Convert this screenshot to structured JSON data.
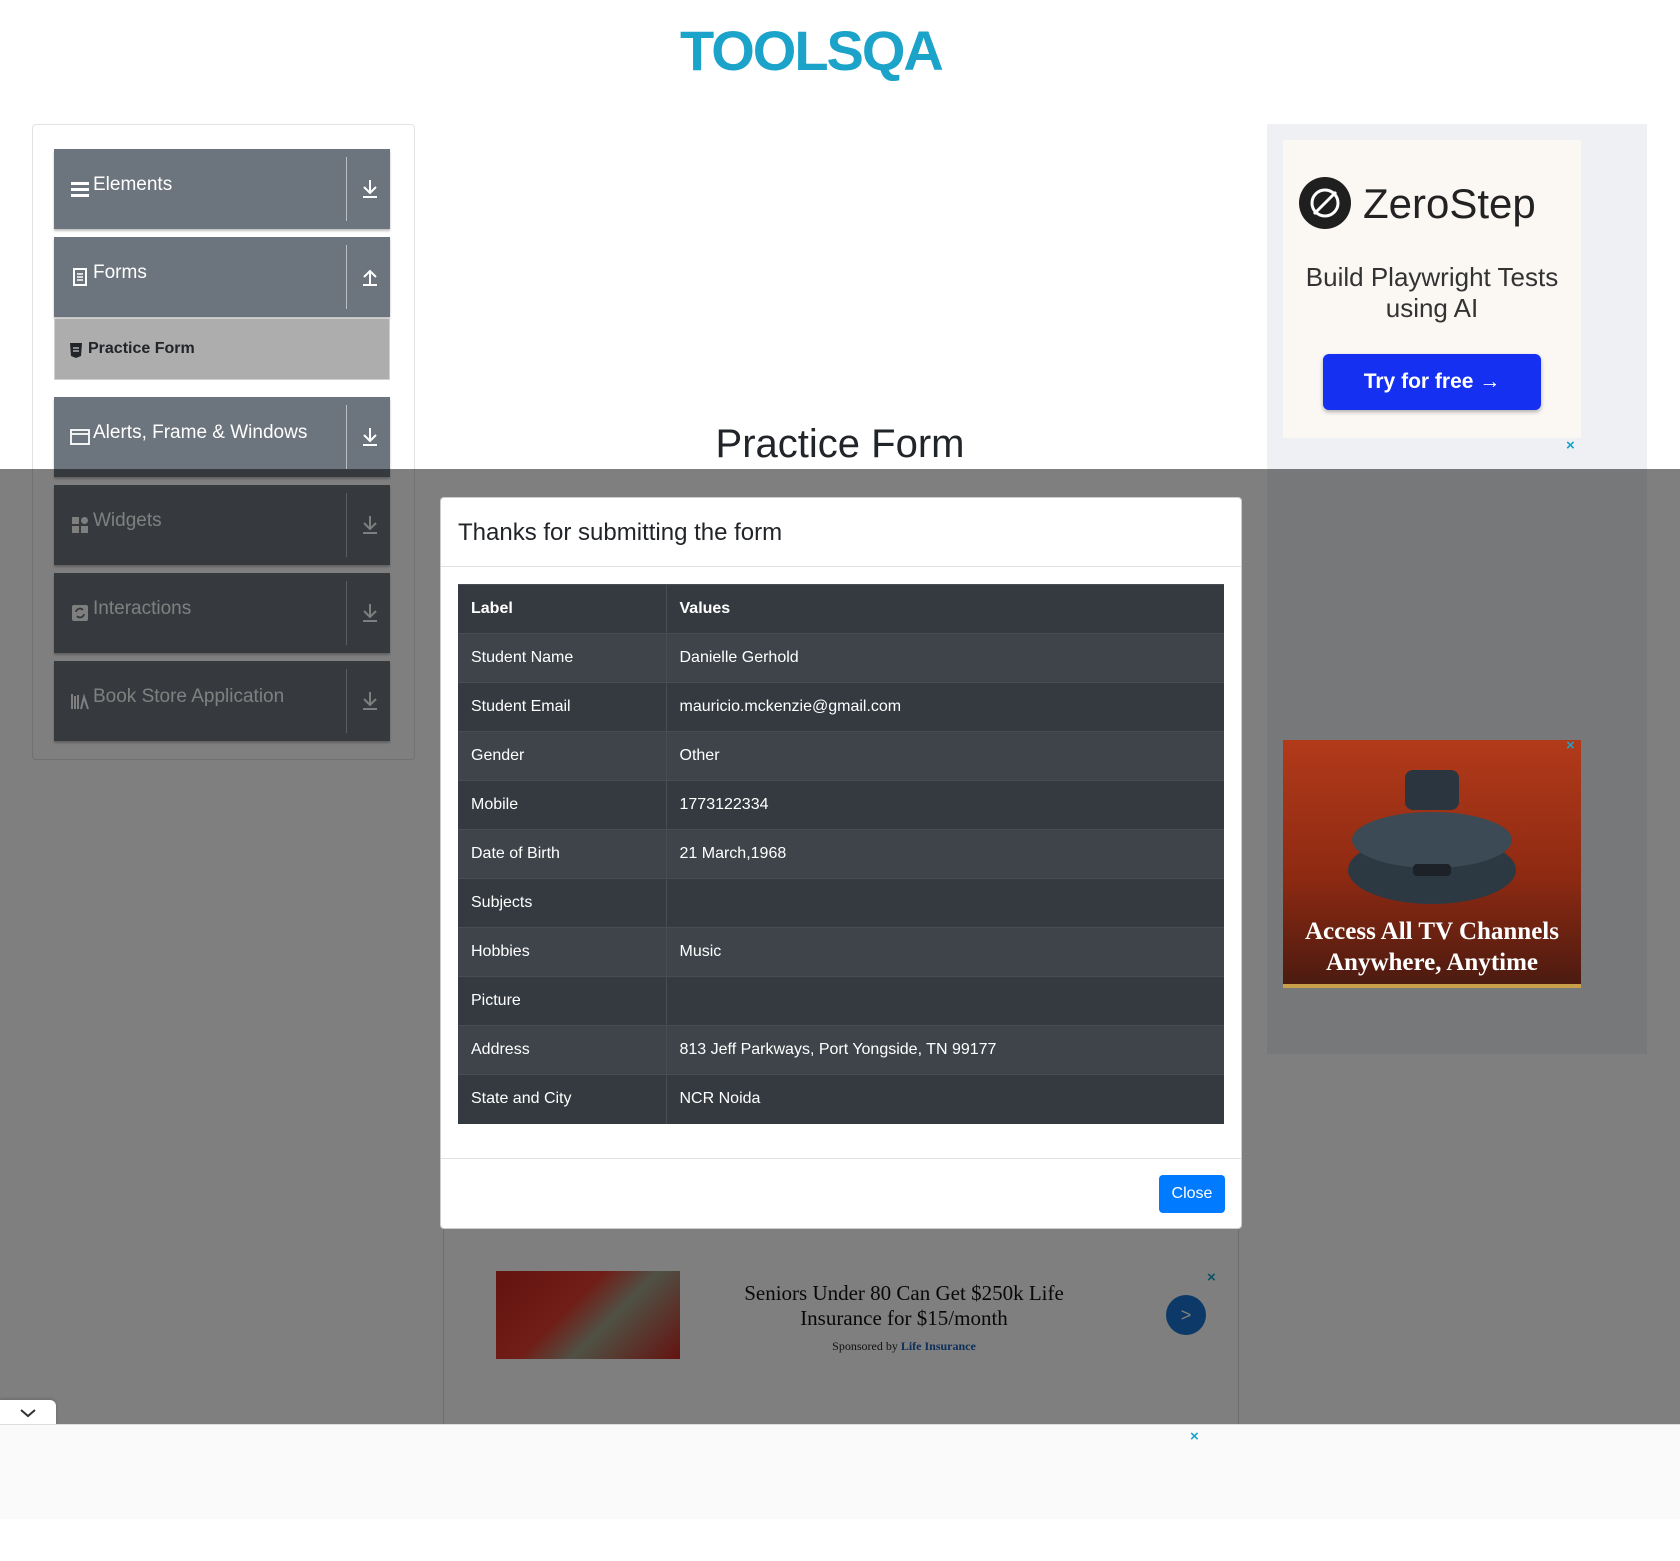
{
  "header": {
    "logo_text": "TOOLSQA"
  },
  "sidebar": {
    "groups": [
      {
        "label": "Elements",
        "icon": "list-icon",
        "state": "collapsed"
      },
      {
        "label": "Forms",
        "icon": "document-icon",
        "state": "expanded"
      },
      {
        "label": "Alerts, Frame & Windows",
        "icon": "window-icon",
        "state": "collapsed"
      },
      {
        "label": "Widgets",
        "icon": "widgets-icon",
        "state": "collapsed"
      },
      {
        "label": "Interactions",
        "icon": "interactions-icon",
        "state": "collapsed"
      },
      {
        "label": "Book Store Application",
        "icon": "books-icon",
        "state": "collapsed"
      }
    ],
    "active_item": {
      "label": "Practice Form",
      "icon": "form-icon"
    }
  },
  "main": {
    "title": "Practice Form"
  },
  "modal": {
    "title": "Thanks for submitting the form",
    "table": {
      "headers": [
        "Label",
        "Values"
      ],
      "rows": [
        [
          "Student Name",
          "Danielle Gerhold"
        ],
        [
          "Student Email",
          "mauricio.mckenzie@gmail.com"
        ],
        [
          "Gender",
          "Other"
        ],
        [
          "Mobile",
          "1773122334"
        ],
        [
          "Date of Birth",
          "21 March,1968"
        ],
        [
          "Subjects",
          ""
        ],
        [
          "Hobbies",
          "Music"
        ],
        [
          "Picture",
          ""
        ],
        [
          "Address",
          "813 Jeff Parkways, Port Yongside, TN 99177"
        ],
        [
          "State and City",
          "NCR Noida"
        ]
      ]
    },
    "close_label": "Close"
  },
  "ads": {
    "zerostep": {
      "brand": "ZeroStep",
      "tagline": "Build Playwright Tests using AI",
      "cta": "Try for free →"
    },
    "tv": {
      "headline": "Access All TV Channels Anywhere, Anytime"
    },
    "bottom": {
      "headline": "Seniors Under 80 Can Get $250k Life Insurance for $15/month",
      "sponsored_prefix": "Sponsored by",
      "sponsor": "Life Insurance",
      "go_label": ">"
    },
    "close_glyph": "×"
  },
  "colors": {
    "accent": "#007bff",
    "sidebar_group": "#6c757d",
    "table_dark": "#343a40",
    "logo_blue": "#1ba3c9"
  }
}
